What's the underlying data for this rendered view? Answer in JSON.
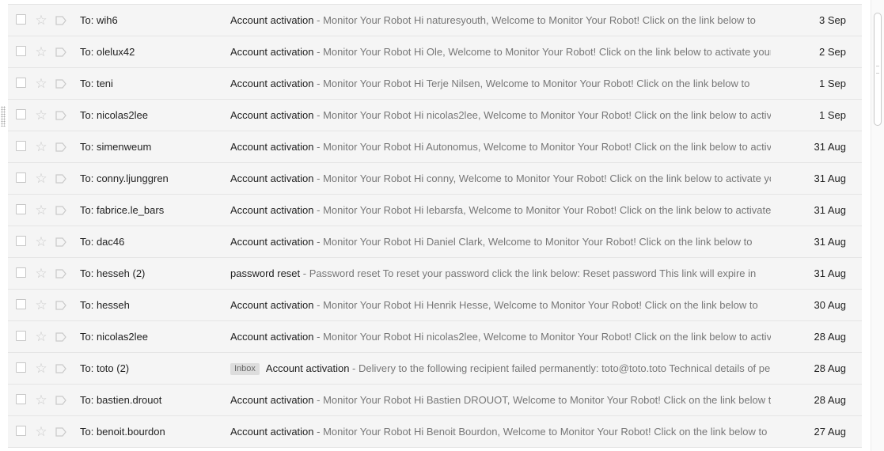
{
  "icons": {
    "star": "☆"
  },
  "emails": [
    {
      "to": "To: wih6",
      "subject": "Account activation",
      "snippet": " - Monitor Your Robot Hi naturesyouth, Welcome to Monitor Your Robot! Click on the link below to",
      "date": "3 Sep"
    },
    {
      "to": "To: olelux42",
      "subject": "Account activation",
      "snippet": " - Monitor Your Robot Hi Ole, Welcome to Monitor Your Robot! Click on the link below to activate your",
      "date": "2 Sep"
    },
    {
      "to": "To: teni",
      "subject": "Account activation",
      "snippet": " - Monitor Your Robot Hi Terje Nilsen, Welcome to Monitor Your Robot! Click on the link below to",
      "date": "1 Sep"
    },
    {
      "to": "To: nicolas2lee",
      "subject": "Account activation",
      "snippet": " - Monitor Your Robot Hi nicolas2lee, Welcome to Monitor Your Robot! Click on the link below to activa",
      "date": "1 Sep"
    },
    {
      "to": "To: simenweum",
      "subject": "Account activation",
      "snippet": " - Monitor Your Robot Hi Autonomus, Welcome to Monitor Your Robot! Click on the link below to activ",
      "date": "31 Aug"
    },
    {
      "to": "To: conny.ljunggren",
      "subject": "Account activation",
      "snippet": " - Monitor Your Robot Hi conny, Welcome to Monitor Your Robot! Click on the link below to activate yc",
      "date": "31 Aug"
    },
    {
      "to": "To: fabrice.le_bars",
      "subject": "Account activation",
      "snippet": " - Monitor Your Robot Hi lebarsfa, Welcome to Monitor Your Robot! Click on the link below to activate",
      "date": "31 Aug"
    },
    {
      "to": "To: dac46",
      "subject": "Account activation",
      "snippet": " - Monitor Your Robot Hi Daniel Clark, Welcome to Monitor Your Robot! Click on the link below to",
      "date": "31 Aug"
    },
    {
      "to": "To: hesseh (2)",
      "subject": "password reset",
      "snippet": " - Password reset To reset your password click the link below: Reset password This link will expire in",
      "date": "31 Aug"
    },
    {
      "to": "To: hesseh",
      "subject": "Account activation",
      "snippet": " - Monitor Your Robot Hi Henrik Hesse, Welcome to Monitor Your Robot! Click on the link below to",
      "date": "30 Aug"
    },
    {
      "to": "To: nicolas2lee",
      "subject": "Account activation",
      "snippet": " - Monitor Your Robot Hi nicolas2lee, Welcome to Monitor Your Robot! Click on the link below to activa",
      "date": "28 Aug"
    },
    {
      "to": "To: toto (2)",
      "label": "Inbox",
      "subject": "Account activation",
      "snippet": " - Delivery to the following recipient failed permanently: toto@toto.toto Technical details of pe",
      "date": "28 Aug"
    },
    {
      "to": "To: bastien.drouot",
      "subject": "Account activation",
      "snippet": " - Monitor Your Robot Hi Bastien DROUOT, Welcome to Monitor Your Robot! Click on the link below t",
      "date": "28 Aug"
    },
    {
      "to": "To: benoit.bourdon",
      "subject": "Account activation",
      "snippet": " - Monitor Your Robot Hi Benoit Bourdon, Welcome to Monitor Your Robot! Click on the link below to",
      "date": "27 Aug"
    }
  ]
}
